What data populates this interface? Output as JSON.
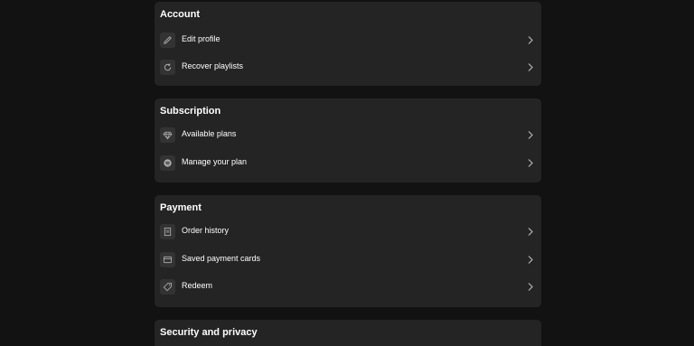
{
  "sections": [
    {
      "title": "Account",
      "items": [
        {
          "label": "Edit profile",
          "icon": "pencil-icon"
        },
        {
          "label": "Recover playlists",
          "icon": "refresh-icon"
        }
      ]
    },
    {
      "title": "Subscription",
      "items": [
        {
          "label": "Available plans",
          "icon": "diamond-icon"
        },
        {
          "label": "Manage your plan",
          "icon": "spotify-icon"
        }
      ]
    },
    {
      "title": "Payment",
      "items": [
        {
          "label": "Order history",
          "icon": "receipt-icon"
        },
        {
          "label": "Saved payment cards",
          "icon": "credit-card-icon"
        },
        {
          "label": "Redeem",
          "icon": "tag-icon"
        }
      ]
    },
    {
      "title": "Security and privacy",
      "items": []
    }
  ],
  "colors": {
    "background": "#121212",
    "card": "#242424",
    "icon_tile": "#333333",
    "text": "#ffffff",
    "chevron": "#b3b3b3"
  }
}
